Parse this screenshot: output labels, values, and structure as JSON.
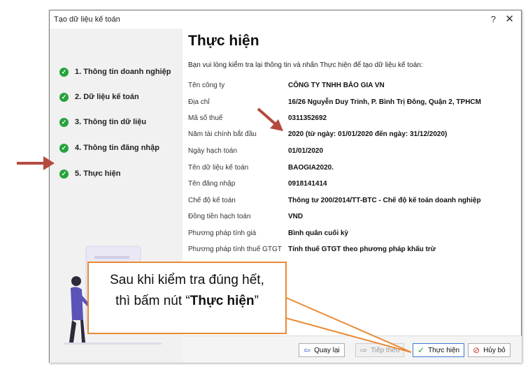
{
  "window": {
    "title": "Tạo dữ liệu kế toán",
    "help": "?",
    "close": "✕"
  },
  "steps": [
    {
      "label": "1. Thông tin doanh nghiệp"
    },
    {
      "label": "2. Dữ liệu kế toán"
    },
    {
      "label": "3. Thông tin dữ liệu"
    },
    {
      "label": "4. Thông tin đăng nhập"
    },
    {
      "label": "5. Thực hiện"
    }
  ],
  "content": {
    "heading": "Thực hiện",
    "intro": "Bạn vui lòng kiểm tra lại thông tin và nhấn Thực hiện để tạo dữ liệu kế toán:",
    "rows": [
      {
        "key": "Tên công ty",
        "value": "CÔNG TY TNHH BẢO GIA VN"
      },
      {
        "key": "Địa chỉ",
        "value": "16/26 Nguyễn Duy Trinh, P. Bình Trị Đông, Quận 2, TPHCM"
      },
      {
        "key": "Mã số thuế",
        "value": "0311352692"
      },
      {
        "key": "Năm tài chính bắt đầu",
        "value": "2020 (từ ngày: 01/01/2020 đến ngày: 31/12/2020)"
      },
      {
        "key": "Ngày hạch toán",
        "value": "01/01/2020"
      },
      {
        "key": "Tên dữ liệu kế toán",
        "value": "BAOGIA2020."
      },
      {
        "key": "Tên đăng nhập",
        "value": "0918141414"
      },
      {
        "key": "Chế độ kế toán",
        "value": "Thông tư 200/2014/TT-BTC - Chế độ kế toán doanh nghiệp"
      },
      {
        "key": "Đồng tiền hạch toán",
        "value": "VND"
      },
      {
        "key": "Phương pháp tính giá",
        "value": "Bình quân cuối kỳ"
      },
      {
        "key": "Phương pháp tính thuế GTGT",
        "value": "Tính thuế GTGT theo phương pháp khấu trừ"
      }
    ]
  },
  "buttons": {
    "back": "Quay lại",
    "next": "Tiếp theo",
    "execute": "Thực hiện",
    "cancel": "Hủy bỏ"
  },
  "annotation": {
    "line1": "Sau khi kiểm tra đúng hết,",
    "line2_prefix": "thì bấm nút “",
    "line2_bold": "Thực hiện",
    "line2_suffix": "”"
  },
  "colors": {
    "check_green": "#27a33c",
    "arrow_red": "#b54a3e",
    "callout_orange": "#e98a35",
    "panel_gray": "#f1f1f1"
  }
}
